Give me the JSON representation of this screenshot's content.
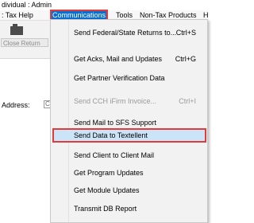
{
  "window": {
    "title": "dividual : Admin"
  },
  "menubar": {
    "items": [
      {
        "label": ": Tax Help"
      },
      {
        "label": "Communications"
      },
      {
        "label": "Tools"
      },
      {
        "label": "Non-Tax Products"
      },
      {
        "label": "H"
      }
    ]
  },
  "toolbar": {
    "close_return_label": "Close Return"
  },
  "form": {
    "address_label": "Address:",
    "address_value": "C"
  },
  "communications_menu": {
    "items": [
      {
        "label": "Send Federal/State Returns to...",
        "shortcut": "Ctrl+S",
        "disabled": false
      },
      {
        "label": "Get Acks, Mail and Updates",
        "shortcut": "Ctrl+G",
        "disabled": false
      },
      {
        "label": "Get Partner Verification Data",
        "shortcut": "",
        "disabled": false
      },
      {
        "label": "Send CCH iFirm Invoice...",
        "shortcut": "Ctrl+I",
        "disabled": true
      },
      {
        "label": "Send Mail to SFS Support",
        "shortcut": "",
        "disabled": false
      },
      {
        "label": "Send Data to Textellent",
        "shortcut": "",
        "disabled": false,
        "highlighted": true
      },
      {
        "label": "Send Client to Client Mail",
        "shortcut": "",
        "disabled": false
      },
      {
        "label": "Get Program Updates",
        "shortcut": "",
        "disabled": false
      },
      {
        "label": "Get Module Updates",
        "shortcut": "",
        "disabled": false
      },
      {
        "label": "Transmit DB Report",
        "shortcut": "",
        "disabled": false
      }
    ]
  },
  "colors": {
    "menu_highlight": "#0a6fd1",
    "annotation_red": "#e23b3b",
    "item_hover": "#cce4f7"
  }
}
